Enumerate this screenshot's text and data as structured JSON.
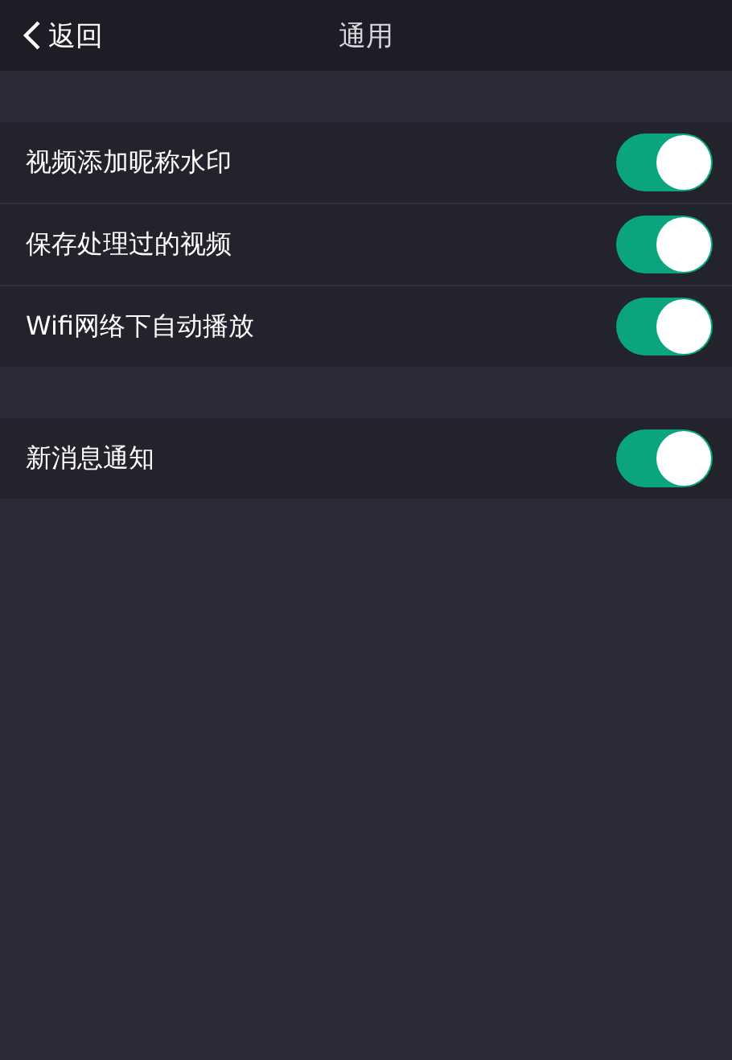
{
  "nav_bar": {
    "back_label": "返回",
    "title": "通用"
  },
  "sections": [
    {
      "rows": [
        {
          "label": "视频添加昵称水印",
          "on": true
        },
        {
          "label": "保存处理过的视频",
          "on": true
        },
        {
          "label": "Wifi网络下自动播放",
          "on": true
        }
      ]
    },
    {
      "rows": [
        {
          "label": "新消息通知",
          "on": true
        }
      ]
    }
  ]
}
